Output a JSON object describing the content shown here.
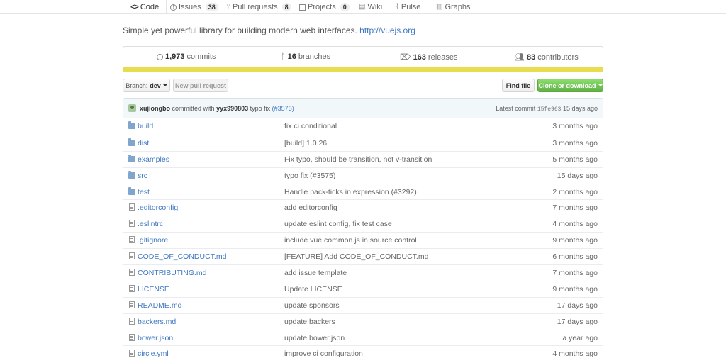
{
  "tabs": [
    {
      "label": "Code",
      "icon": "code-icon",
      "count": null
    },
    {
      "label": "Issues",
      "icon": "issue-icon",
      "count": "38"
    },
    {
      "label": "Pull requests",
      "icon": "pull-request-icon",
      "count": "8"
    },
    {
      "label": "Projects",
      "icon": "project-icon",
      "count": "0"
    },
    {
      "label": "Wiki",
      "icon": "wiki-icon",
      "count": null
    },
    {
      "label": "Pulse",
      "icon": "pulse-icon",
      "count": null
    },
    {
      "label": "Graphs",
      "icon": "graph-icon",
      "count": null
    }
  ],
  "description": {
    "text": "Simple yet powerful library for building modern web interfaces.",
    "link": "http://vuejs.org"
  },
  "summary": {
    "commits": {
      "count": "1,973",
      "label": "commits"
    },
    "branches": {
      "count": "16",
      "label": "branches"
    },
    "releases": {
      "count": "163",
      "label": "releases"
    },
    "contributors": {
      "count": "83",
      "label": "contributors"
    }
  },
  "language_color": "#e8dd4e",
  "controls": {
    "branch_prefix": "Branch:",
    "branch_name": "dev",
    "new_pr": "New pull request",
    "find_file": "Find file",
    "clone": "Clone or download"
  },
  "latest_commit": {
    "author": "xujiongbo",
    "verb": "committed with",
    "committer": "yyx990803",
    "message": "typo fix",
    "issue_link": "(#3575)",
    "label": "Latest commit",
    "sha": "15fe963",
    "age": "15 days ago"
  },
  "files": [
    {
      "type": "dir",
      "name": "build",
      "message": "fix ci conditional",
      "age": "3 months ago"
    },
    {
      "type": "dir",
      "name": "dist",
      "message": "[build] 1.0.26",
      "age": "3 months ago"
    },
    {
      "type": "dir",
      "name": "examples",
      "message": "Fix typo, should be transition, not v-transition",
      "age": "5 months ago"
    },
    {
      "type": "dir",
      "name": "src",
      "message": "typo fix (#3575)",
      "age": "15 days ago"
    },
    {
      "type": "dir",
      "name": "test",
      "message": "Handle back-ticks in expression (#3292)",
      "age": "2 months ago"
    },
    {
      "type": "file",
      "name": ".editorconfig",
      "message": "add editorconfig",
      "age": "7 months ago"
    },
    {
      "type": "file",
      "name": ".eslintrc",
      "message": "update eslint config, fix test case",
      "age": "4 months ago"
    },
    {
      "type": "file",
      "name": ".gitignore",
      "message": "include vue.common.js in source control",
      "age": "9 months ago"
    },
    {
      "type": "file",
      "name": "CODE_OF_CONDUCT.md",
      "message": "[FEATURE] Add CODE_OF_CONDUCT.md",
      "age": "6 months ago"
    },
    {
      "type": "file",
      "name": "CONTRIBUTING.md",
      "message": "add issue template",
      "age": "7 months ago"
    },
    {
      "type": "file",
      "name": "LICENSE",
      "message": "Update LICENSE",
      "age": "9 months ago"
    },
    {
      "type": "file",
      "name": "README.md",
      "message": "update sponsors",
      "age": "17 days ago"
    },
    {
      "type": "file",
      "name": "backers.md",
      "message": "update backers",
      "age": "17 days ago"
    },
    {
      "type": "file",
      "name": "bower.json",
      "message": "update bower.json",
      "age": "a year ago"
    },
    {
      "type": "file",
      "name": "circle.yml",
      "message": "improve ci configuration",
      "age": "4 months ago"
    }
  ]
}
